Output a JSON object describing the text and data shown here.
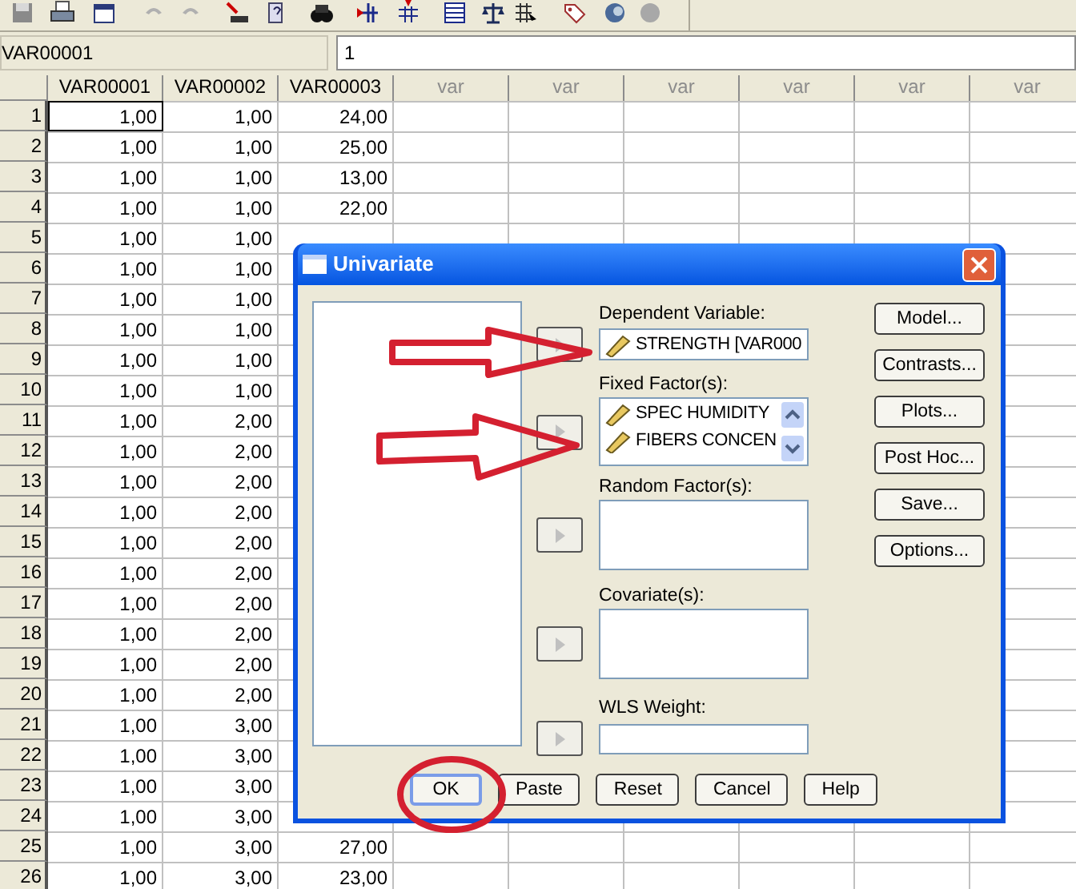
{
  "cell_editor": {
    "variable": "VAR00001",
    "value": "1"
  },
  "grid": {
    "columns": [
      {
        "label": "VAR00001",
        "kind": "defined"
      },
      {
        "label": "VAR00002",
        "kind": "defined"
      },
      {
        "label": "VAR00003",
        "kind": "defined"
      },
      {
        "label": "var",
        "kind": "empty"
      },
      {
        "label": "var",
        "kind": "empty"
      },
      {
        "label": "var",
        "kind": "empty"
      },
      {
        "label": "var",
        "kind": "empty"
      },
      {
        "label": "var",
        "kind": "empty"
      },
      {
        "label": "var",
        "kind": "empty"
      }
    ],
    "rows": [
      {
        "number": "1",
        "selected": true,
        "cells": [
          "1,00",
          "1,00",
          "24,00"
        ]
      },
      {
        "number": "2",
        "selected": false,
        "cells": [
          "1,00",
          "1,00",
          "25,00"
        ]
      },
      {
        "number": "3",
        "selected": false,
        "cells": [
          "1,00",
          "1,00",
          "13,00"
        ]
      },
      {
        "number": "4",
        "selected": false,
        "cells": [
          "1,00",
          "1,00",
          "22,00"
        ]
      },
      {
        "number": "5",
        "selected": false,
        "cells": [
          "1,00",
          "1,00"
        ]
      },
      {
        "number": "6",
        "selected": false,
        "cells": [
          "1,00",
          "1,00"
        ]
      },
      {
        "number": "7",
        "selected": false,
        "cells": [
          "1,00",
          "1,00"
        ]
      },
      {
        "number": "8",
        "selected": false,
        "cells": [
          "1,00",
          "1,00"
        ]
      },
      {
        "number": "9",
        "selected": false,
        "cells": [
          "1,00",
          "1,00"
        ]
      },
      {
        "number": "10",
        "selected": false,
        "cells": [
          "1,00",
          "1,00"
        ]
      },
      {
        "number": "11",
        "selected": false,
        "cells": [
          "1,00",
          "2,00"
        ]
      },
      {
        "number": "12",
        "selected": false,
        "cells": [
          "1,00",
          "2,00"
        ]
      },
      {
        "number": "13",
        "selected": false,
        "cells": [
          "1,00",
          "2,00"
        ]
      },
      {
        "number": "14",
        "selected": false,
        "cells": [
          "1,00",
          "2,00"
        ]
      },
      {
        "number": "15",
        "selected": false,
        "cells": [
          "1,00",
          "2,00"
        ]
      },
      {
        "number": "16",
        "selected": false,
        "cells": [
          "1,00",
          "2,00"
        ]
      },
      {
        "number": "17",
        "selected": false,
        "cells": [
          "1,00",
          "2,00"
        ]
      },
      {
        "number": "18",
        "selected": false,
        "cells": [
          "1,00",
          "2,00"
        ]
      },
      {
        "number": "19",
        "selected": false,
        "cells": [
          "1,00",
          "2,00"
        ]
      },
      {
        "number": "20",
        "selected": false,
        "cells": [
          "1,00",
          "2,00"
        ]
      },
      {
        "number": "21",
        "selected": false,
        "cells": [
          "1,00",
          "3,00"
        ]
      },
      {
        "number": "22",
        "selected": false,
        "cells": [
          "1,00",
          "3,00"
        ]
      },
      {
        "number": "23",
        "selected": false,
        "cells": [
          "1,00",
          "3,00"
        ]
      },
      {
        "number": "24",
        "selected": false,
        "cells": [
          "1,00",
          "3,00"
        ]
      },
      {
        "number": "25",
        "selected": false,
        "cells": [
          "1,00",
          "3,00",
          "27,00"
        ]
      },
      {
        "number": "26",
        "selected": false,
        "cells": [
          "1,00",
          "3,00",
          "23,00"
        ]
      }
    ]
  },
  "dialog": {
    "title": "Univariate",
    "targets": [
      {
        "label": "Dependent Variable:",
        "kind": "single",
        "disabled": true,
        "items": [
          "STRENGTH [VAR000"
        ]
      },
      {
        "label": "Fixed Factor(s):",
        "kind": "list",
        "disabled": true,
        "items": [
          "SPEC HUMIDITY",
          "FIBERS CONCEN"
        ]
      },
      {
        "label": "Random Factor(s):",
        "kind": "list",
        "disabled": true
      },
      {
        "label": "Covariate(s):",
        "kind": "list",
        "disabled": true
      },
      {
        "label": "WLS Weight:",
        "kind": "single",
        "disabled": true
      }
    ],
    "side_buttons": [
      "Model...",
      "Contrasts...",
      "Plots...",
      "Post Hoc...",
      "Save...",
      "Options..."
    ],
    "buttons": [
      {
        "label": "OK",
        "default": true
      },
      {
        "label": "Paste",
        "default": false
      },
      {
        "label": "Reset",
        "default": false
      },
      {
        "label": "Cancel",
        "default": false
      },
      {
        "label": "Help",
        "default": false
      }
    ]
  }
}
